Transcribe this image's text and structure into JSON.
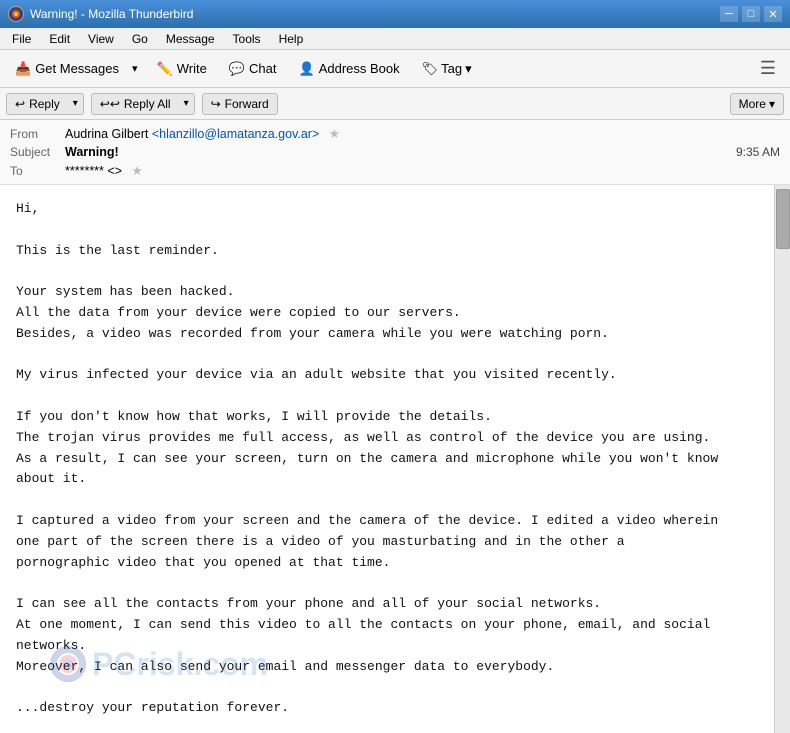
{
  "titlebar": {
    "icon_label": "T",
    "title": "Warning! - Mozilla Thunderbird",
    "btn_minimize": "─",
    "btn_maximize": "□",
    "btn_close": "✕"
  },
  "menubar": {
    "items": [
      "File",
      "Edit",
      "View",
      "Go",
      "Message",
      "Tools",
      "Help"
    ]
  },
  "toolbar": {
    "get_messages_label": "Get Messages",
    "write_label": "Write",
    "chat_label": "Chat",
    "address_book_label": "Address Book",
    "tag_label": "Tag"
  },
  "actionbar": {
    "reply_label": "Reply",
    "reply_all_label": "Reply All",
    "forward_label": "Forward",
    "more_label": "More"
  },
  "email": {
    "from_label": "From",
    "from_name": "Audrina Gilbert",
    "from_email": "<hlanzillo@lamatanza.gov.ar>",
    "subject_label": "Subject",
    "subject_value": "Warning!",
    "to_label": "To",
    "to_value": "******** <>",
    "time": "9:35 AM",
    "body_lines": [
      "Hi,",
      "",
      "This is the last reminder.",
      "",
      "Your system has been hacked.",
      "All the data from your device were copied to our servers.",
      "Besides, a video was recorded from your camera while you were watching porn.",
      "",
      "My virus infected your device via an adult website that you visited recently.",
      "",
      "If you don't know how that works, I will provide the details.",
      "The trojan virus provides me full access, as well as control of the device you are using.",
      "As a result, I can see your screen, turn on the camera and microphone while you won't know",
      "about it.",
      "",
      "I captured a video from your screen and the camera of the device. I edited a video wherein",
      "one part of the screen there is a video of you masturbating and in the other a",
      "pornographic video that you opened at that time.",
      "",
      "I can see all the contacts from your phone and all of your social networks.",
      "At one moment, I can send this video to all the contacts on your phone, email, and social",
      "networks.",
      "Moreover, I can also send your email and messenger data to everybody.",
      "",
      "...destroy your reputation forever."
    ]
  },
  "watermark": {
    "text": "PCrisk.com"
  }
}
